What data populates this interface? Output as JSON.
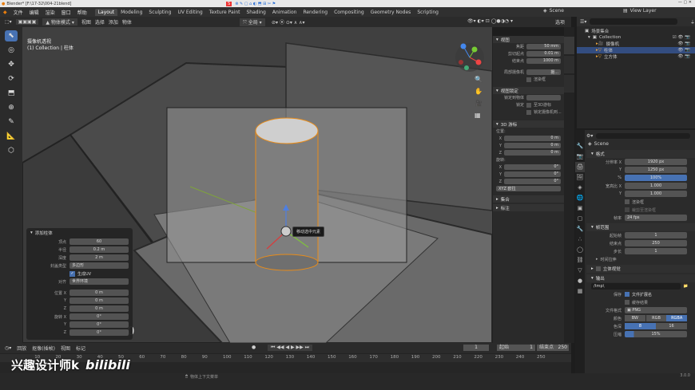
{
  "titlebar": {
    "title": "Blender* [F:\\17-32\\004-21blend]"
  },
  "menu": [
    "文件",
    "编辑",
    "渲染",
    "窗口",
    "帮助"
  ],
  "workspaces": [
    "Layout",
    "Modeling",
    "Sculpting",
    "UV Editing",
    "Texture Paint",
    "Shading",
    "Animation",
    "Rendering",
    "Compositing",
    "Geometry Nodes",
    "Scripting"
  ],
  "active_workspace": "Layout",
  "scene": "Scene",
  "view_layer": "View Layer",
  "header": {
    "mode": "物体模式",
    "view": "视图",
    "select": "选择",
    "add": "添加",
    "object": "物体",
    "orientation": "全局",
    "options": "选项"
  },
  "viewport": {
    "title": "摄像机透视",
    "subtitle": "(1) Collection | 柱体",
    "tooltip": "移动选中元素",
    "frame_number": "0"
  },
  "npanel": {
    "view_header": "视图",
    "focal_label": "焦距",
    "focal": "50 mm",
    "clip_start_label": "剪切起点",
    "clip_start": "0.01 m",
    "clip_end_label": "结束点",
    "clip_end": "1000 m",
    "local_camera_label": "局部摄像机",
    "local_camera": "摄...",
    "render_region": "渲染框",
    "view_lock_header": "视图锁定",
    "lock_object_label": "锁定到物体",
    "lock_label": "锁定",
    "lock_3d_cursor": "至3D游标",
    "lock_camera": "锁定摄像机到...",
    "cursor_header": "3D 游标",
    "location_label": "位置:",
    "x": "0 m",
    "y": "0 m",
    "z": "0 m",
    "rotation_label": "旋转:",
    "rx": "0°",
    "ry": "0°",
    "rz": "0°",
    "rotation_mode": "XYZ 欧拉",
    "collections_header": "集合",
    "annotations_header": "标注"
  },
  "op_panel": {
    "title": "添加柱体",
    "vertices_label": "顶点",
    "vertices": "60",
    "radius_label": "半径",
    "radius": "0.2 m",
    "depth_label": "深度",
    "depth": "2 m",
    "cap_label": "封盖类型",
    "cap": "多边形",
    "uv_label": "生成UV",
    "align_label": "对齐",
    "align": "世界环境",
    "loc_label": "位置 X",
    "lx": "0 m",
    "ly": "0 m",
    "lz": "0 m",
    "rot_label": "旋转 X",
    "rx": "0°",
    "ry": "0°",
    "rz": "0°",
    "y_label": "Y",
    "z_label": "Z"
  },
  "outliner": {
    "header": "场景集合",
    "items": [
      {
        "label": "Collection"
      },
      {
        "label": "摄像机"
      },
      {
        "label": "柱体"
      },
      {
        "label": "立方体"
      }
    ]
  },
  "properties": {
    "scene_name": "Scene",
    "format_header": "格式",
    "res_x_label": "分辨率 X",
    "res_x": "1920 px",
    "res_y_label": "Y",
    "res_y": "1250 px",
    "percent_label": "%",
    "percent": "100%",
    "aspect_x_label": "宽高比 X",
    "aspect_x": "1.000",
    "aspect_y_label": "Y",
    "aspect_y": "1.000",
    "render_region": "渲染框",
    "crop": "裁剪至渲染框",
    "fps_label": "帧率",
    "fps": "24 fps",
    "frame_range_header": "帧范围",
    "frame_start_label": "起始帧",
    "frame_start": "1",
    "frame_end_label": "结束点",
    "frame_end": "250",
    "step_label": "步长",
    "step": "1",
    "time_stretch": "时间拉伸",
    "stereo": "立体视觉",
    "output_header": "输出",
    "path": "/tmp\\",
    "saving_label": "保存",
    "file_ext": "文件扩展名",
    "cache": "缓存结果",
    "file_format_label": "文件格式",
    "file_format": "PNG",
    "color_label": "颜色",
    "bw": "BW",
    "rgb": "RGB",
    "rgba": "RGBA",
    "depth_label": "色深",
    "depth8": "8",
    "depth16": "16",
    "compression_label": "压缩",
    "compression": "15%"
  },
  "timeline": {
    "playback": "回放",
    "keying": "抠像(插帧)",
    "view": "视图",
    "marker": "标记",
    "current": "1",
    "start_label": "起始",
    "start": "1",
    "end_label": "结束点",
    "end": "250",
    "ticks": [
      "10",
      "20",
      "30",
      "40",
      "50",
      "60",
      "70",
      "80",
      "90",
      "100",
      "110",
      "120",
      "130",
      "140",
      "150",
      "160",
      "170",
      "180",
      "190",
      "200",
      "210",
      "220",
      "230",
      "240",
      "250"
    ]
  },
  "status": {
    "hint": "物体上下文菜单",
    "version": "3.0.0"
  },
  "watermark": {
    "text": "兴趣设计师k",
    "brand": "bilibili"
  }
}
